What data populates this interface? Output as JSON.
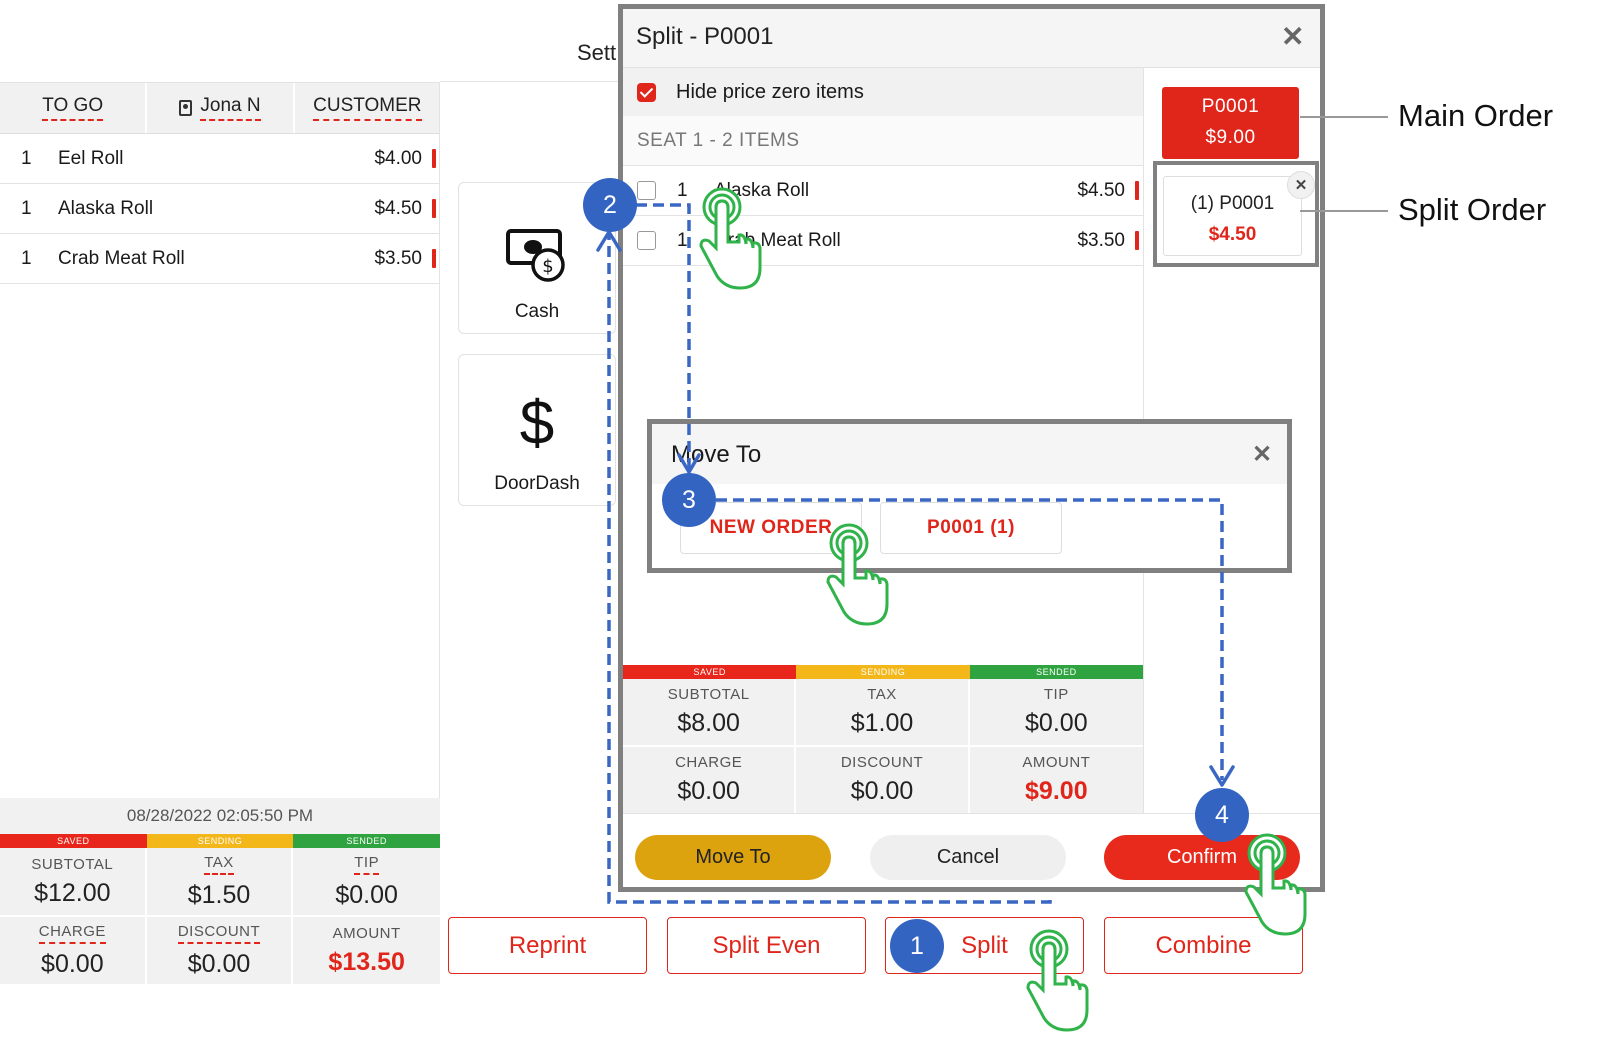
{
  "left_panel": {
    "tabs": [
      {
        "label": "TO GO"
      },
      {
        "label": "Jona N",
        "icon": "contact-card-icon"
      },
      {
        "label": "CUSTOMER"
      }
    ],
    "items": [
      {
        "qty": "1",
        "name": "Eel Roll",
        "price": "$4.00"
      },
      {
        "qty": "1",
        "name": "Alaska Roll",
        "price": "$4.50"
      },
      {
        "qty": "1",
        "name": "Crab Meat Roll",
        "price": "$3.50"
      }
    ],
    "datetime": "08/28/2022 02:05:50 PM",
    "status": [
      "SAVED",
      "SENDING",
      "SENDED"
    ],
    "totals": [
      {
        "label": "SUBTOTAL",
        "value": "$12.00"
      },
      {
        "label": "TAX",
        "value": "$1.50"
      },
      {
        "label": "TIP",
        "value": "$0.00"
      },
      {
        "label": "CHARGE",
        "value": "$0.00"
      },
      {
        "label": "DISCOUNT",
        "value": "$0.00"
      },
      {
        "label": "AMOUNT",
        "value": "$13.50"
      }
    ]
  },
  "background": {
    "settings_partial": "Sett",
    "payment_methods": [
      {
        "label": "Cash",
        "icon": "cash-icon"
      },
      {
        "label": "DoorDash",
        "icon": "dollar-icon"
      }
    ]
  },
  "split_dialog": {
    "title": "Split - P0001",
    "hide_zero_label": "Hide price zero items",
    "seat_header": "SEAT 1 - 2 ITEMS",
    "items": [
      {
        "qty": "1",
        "name": "Alaska Roll",
        "price": "$4.50"
      },
      {
        "qty": "1",
        "name": "Crab Meat Roll",
        "price": "$3.50"
      }
    ],
    "main_order": {
      "id": "P0001",
      "amount": "$9.00"
    },
    "split_order": {
      "id": "(1) P0001",
      "amount": "$4.50"
    },
    "status": [
      "SAVED",
      "SENDING",
      "SENDED"
    ],
    "totals": [
      {
        "label": "SUBTOTAL",
        "value": "$8.00"
      },
      {
        "label": "TAX",
        "value": "$1.00"
      },
      {
        "label": "TIP",
        "value": "$0.00"
      },
      {
        "label": "CHARGE",
        "value": "$0.00"
      },
      {
        "label": "DISCOUNT",
        "value": "$0.00"
      },
      {
        "label": "AMOUNT",
        "value": "$9.00"
      }
    ],
    "buttons": {
      "move_to": "Move To",
      "cancel": "Cancel",
      "confirm": "Confirm"
    }
  },
  "move_dialog": {
    "title": "Move To",
    "options": [
      "NEW ORDER",
      "P0001 (1)"
    ]
  },
  "bottom_buttons": [
    "Reprint",
    "Split Even",
    "Split",
    "Combine"
  ],
  "annotations": {
    "main_order": "Main Order",
    "split_order": "Split Order",
    "steps": [
      "1",
      "2",
      "3",
      "4"
    ]
  },
  "colors": {
    "accent_red": "#e0261b",
    "move_to_button": "#dca30f",
    "step_blue": "#3364c2",
    "touch_green": "#2fb34a",
    "saved": "#e8261c",
    "sending": "#f3b71a",
    "sended": "#2fa33f"
  }
}
